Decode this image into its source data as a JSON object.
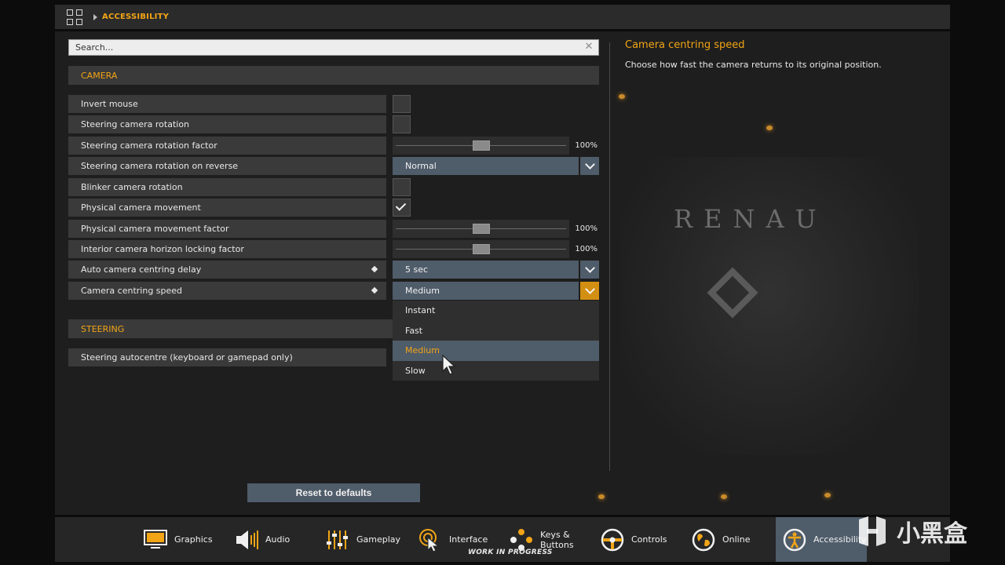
{
  "breadcrumb": {
    "current": "ACCESSIBILITY"
  },
  "search": {
    "placeholder": "Search..."
  },
  "sections": {
    "camera": "CAMERA",
    "steering": "STEERING"
  },
  "settings": [
    {
      "label": "Invert mouse",
      "control": "checkbox",
      "checked": false
    },
    {
      "label": "Steering camera rotation",
      "control": "checkbox",
      "checked": false
    },
    {
      "label": "Steering camera rotation factor",
      "control": "slider",
      "value": "100%",
      "level": 0.5
    },
    {
      "label": "Steering camera rotation on reverse",
      "control": "dropdown",
      "value": "Normal"
    },
    {
      "label": "Blinker camera rotation",
      "control": "checkbox",
      "checked": false
    },
    {
      "label": "Physical camera movement",
      "control": "checkbox",
      "checked": true
    },
    {
      "label": "Physical camera movement factor",
      "control": "slider",
      "value": "100%",
      "level": 0.5
    },
    {
      "label": "Interior camera horizon locking factor",
      "control": "slider",
      "value": "100%",
      "level": 0.5
    },
    {
      "label": "Auto camera centring delay",
      "control": "dropdown",
      "value": "5 sec",
      "modified": true
    },
    {
      "label": "Camera centring speed",
      "control": "dropdown",
      "value": "Medium",
      "modified": true,
      "open": true
    }
  ],
  "steering_settings": [
    {
      "label": "Steering autocentre (keyboard or gamepad only)"
    }
  ],
  "dropdown_open": {
    "options": [
      "Instant",
      "Fast",
      "Medium",
      "Slow"
    ],
    "highlighted": "Medium"
  },
  "help": {
    "title": "Camera centring speed",
    "text": "Choose how fast the camera returns to its original position."
  },
  "reset_label": "Reset to defaults",
  "nav": {
    "items": [
      {
        "label": "Graphics",
        "icon": "monitor-icon"
      },
      {
        "label": "Audio",
        "icon": "speaker-icon"
      },
      {
        "label": "Gameplay",
        "icon": "sliders-icon"
      },
      {
        "label": "Interface",
        "icon": "cursor-icon"
      },
      {
        "label": "Keys &",
        "label2": "Buttons",
        "icon": "gamepad-buttons-icon"
      },
      {
        "label": "Controls",
        "icon": "steering-wheel-icon"
      },
      {
        "label": "Online",
        "icon": "globe-icon"
      },
      {
        "label": "Accessibility",
        "icon": "accessibility-icon",
        "active": true
      }
    ],
    "wip_text": "WORK IN PROGRESS"
  },
  "background": {
    "brand_text": "RENAU"
  },
  "watermark": {
    "text": "小黑盒"
  },
  "colors": {
    "accent": "#f2a516",
    "control_blue": "#4f5c6a",
    "active_orange": "#d38f12"
  }
}
